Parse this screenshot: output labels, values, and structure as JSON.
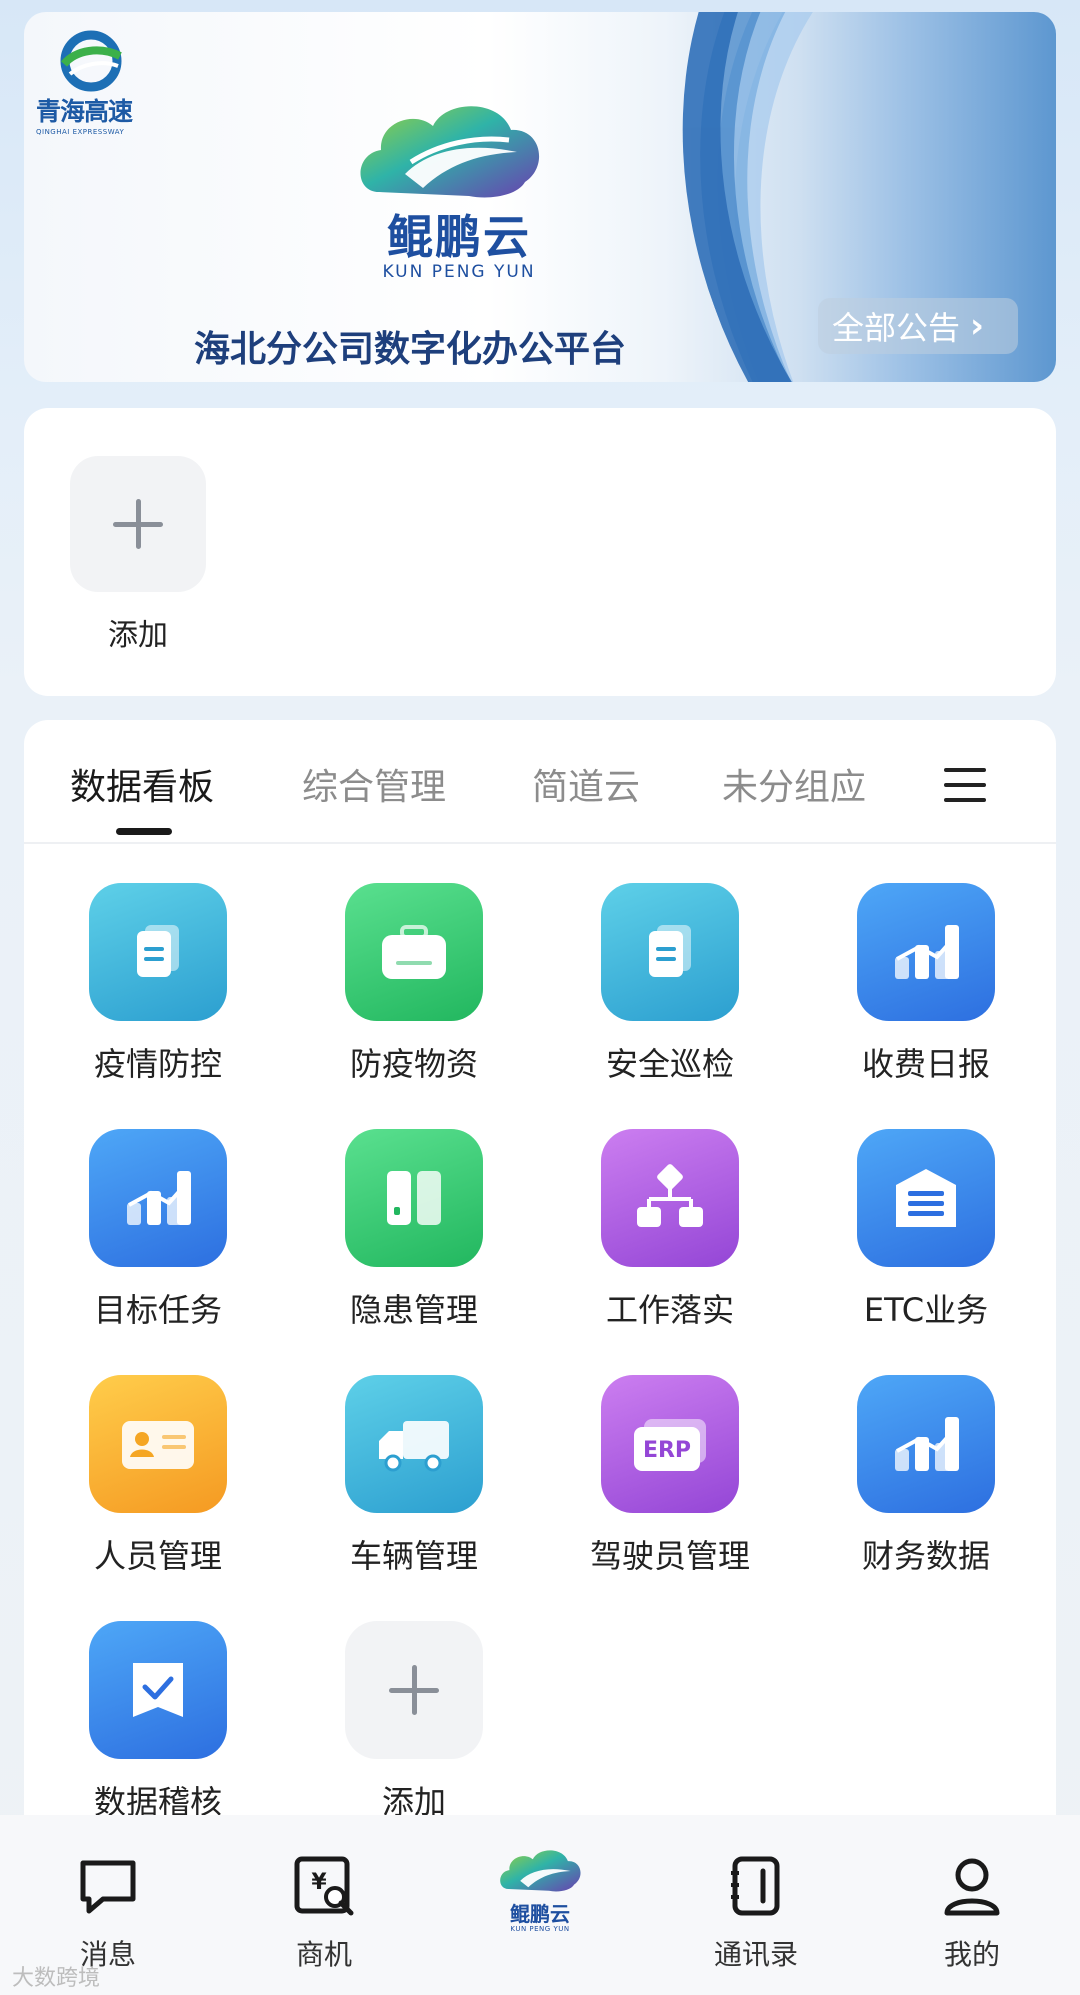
{
  "banner": {
    "corp_logo_name": "青海高速",
    "corp_logo_sub": "QINGHAI EXPRESSWAY",
    "brand_cn": "鲲鹏云",
    "brand_en": "KUN PENG YUN",
    "platform_title": "海北分公司数字化办公平台",
    "notice_button": "全部公告"
  },
  "quick_access": {
    "add_label": "添加"
  },
  "tabs": [
    {
      "label": "数据看板",
      "active": true
    },
    {
      "label": "综合管理",
      "active": false
    },
    {
      "label": "简道云",
      "active": false
    },
    {
      "label": "未分组应",
      "active": false
    }
  ],
  "apps": [
    {
      "label": "疫情防控",
      "icon": "document-icon",
      "color": "teal"
    },
    {
      "label": "防疫物资",
      "icon": "briefcase-icon",
      "color": "green"
    },
    {
      "label": "安全巡检",
      "icon": "document-icon",
      "color": "teal"
    },
    {
      "label": "收费日报",
      "icon": "bar-chart-icon",
      "color": "blue"
    },
    {
      "label": "目标任务",
      "icon": "bar-chart-icon",
      "color": "blue"
    },
    {
      "label": "隐患管理",
      "icon": "panels-icon",
      "color": "green"
    },
    {
      "label": "工作落实",
      "icon": "flowchart-icon",
      "color": "purple"
    },
    {
      "label": "ETC业务",
      "icon": "warehouse-icon",
      "color": "blue"
    },
    {
      "label": "人员管理",
      "icon": "id-card-icon",
      "color": "orange"
    },
    {
      "label": "车辆管理",
      "icon": "truck-icon",
      "color": "teal"
    },
    {
      "label": "驾驶员管理",
      "icon": "erp-icon",
      "color": "purple"
    },
    {
      "label": "财务数据",
      "icon": "bar-chart-icon",
      "color": "blue"
    },
    {
      "label": "数据稽核",
      "icon": "checkmark-icon",
      "color": "blue"
    },
    {
      "label": "添加",
      "icon": "plus-icon",
      "color": "gray"
    }
  ],
  "app_icon_texts": {
    "erp": "ERP"
  },
  "bottom_nav": {
    "items": [
      {
        "label": "消息",
        "icon": "message-icon"
      },
      {
        "label": "商机",
        "icon": "business-icon"
      },
      {
        "label": "",
        "icon": "kunpeng-logo"
      },
      {
        "label": "通讯录",
        "icon": "contacts-icon"
      },
      {
        "label": "我的",
        "icon": "profile-icon"
      }
    ],
    "center_logo_cn": "鲲鹏云",
    "center_logo_en": "KUN PENG YUN"
  },
  "watermark": "大数跨境"
}
